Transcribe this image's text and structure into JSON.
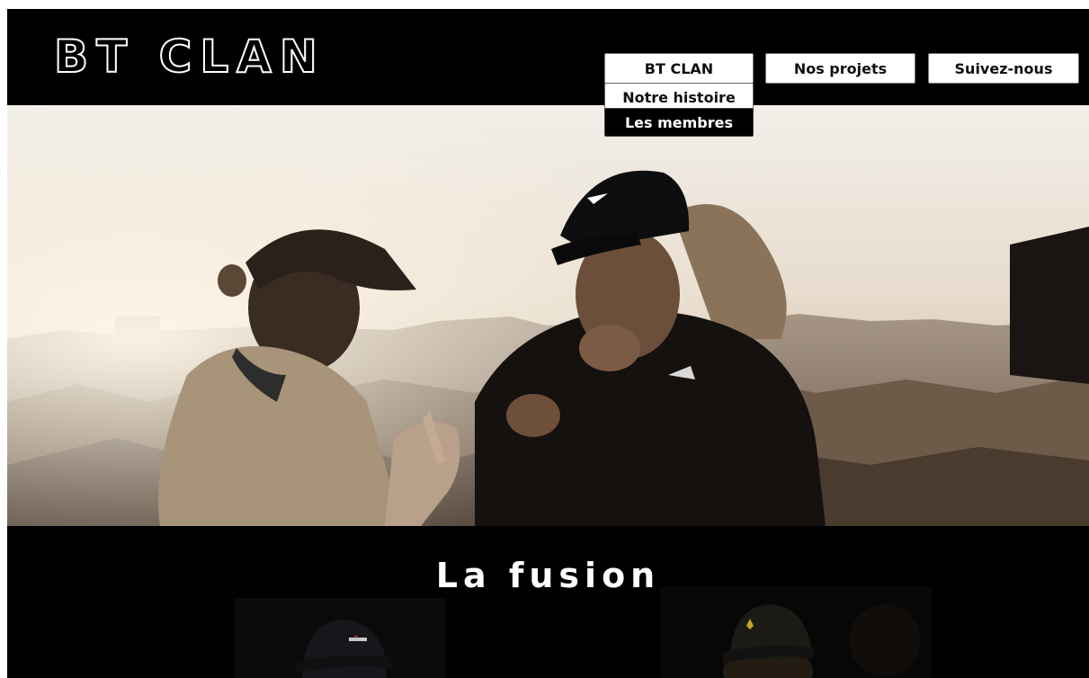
{
  "brand": {
    "logo": "BT CLAN"
  },
  "nav": {
    "items": [
      {
        "label": "BT CLAN"
      },
      {
        "label": "Nos projets"
      },
      {
        "label": "Suivez-nous"
      }
    ],
    "dropdown": [
      {
        "label": "Notre histoire"
      },
      {
        "label": "Les membres"
      }
    ]
  },
  "hero": {
    "image": "rooftop-duo-photo"
  },
  "section": {
    "title": "La fusion"
  },
  "members": [
    {
      "image": "member-photo-black-cap"
    },
    {
      "image": "member-photo-polo-cap"
    }
  ]
}
